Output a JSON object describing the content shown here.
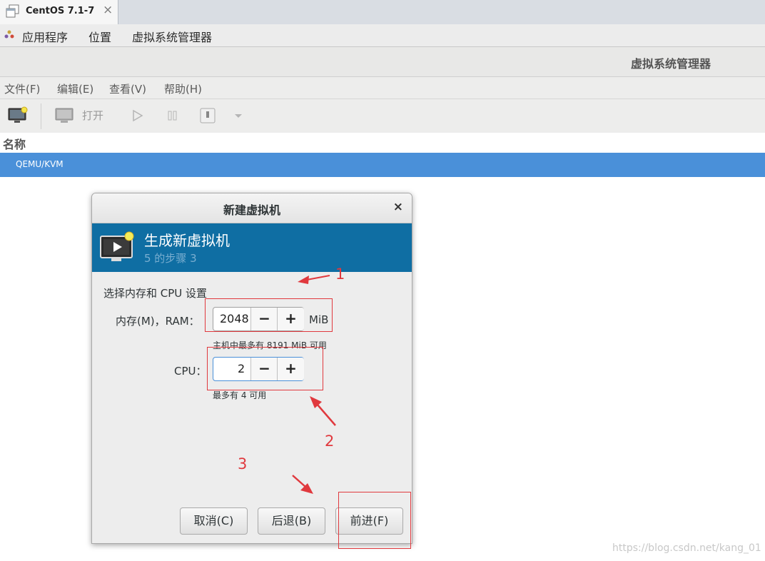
{
  "tab": {
    "title": "CentOS 7.1-7",
    "close": "×"
  },
  "top_menu": {
    "applications": "应用程序",
    "places": "位置",
    "vmm": "虚拟系统管理器"
  },
  "window_title": "虚拟系统管理器",
  "menubar": {
    "file": "文件(F)",
    "edit": "编辑(E)",
    "view": "查看(V)",
    "help": "帮助(H)"
  },
  "toolbar": {
    "open_label": "打开"
  },
  "list": {
    "header": "名称",
    "rows": [
      "QEMU/KVM"
    ]
  },
  "dialog": {
    "title": "新建虚拟机",
    "close": "×",
    "banner_title": "生成新虚拟机",
    "banner_subtitle": "5 的步骤 3",
    "section_label": "选择内存和 CPU 设置",
    "memory": {
      "label": "内存(M)，RAM：",
      "value": "2048",
      "unit": "MiB",
      "hint": "主机中最多有 8191 MiB 可用",
      "minus": "−",
      "plus": "+"
    },
    "cpu": {
      "label": "CPU：",
      "value": "2",
      "hint": "最多有 4 可用",
      "minus": "−",
      "plus": "+"
    },
    "buttons": {
      "cancel": "取消(C)",
      "back": "后退(B)",
      "forward": "前进(F)"
    }
  },
  "annotations": {
    "n1": "1",
    "n2": "2",
    "n3": "3"
  },
  "watermark": "https://blog.csdn.net/kang_01",
  "colors": {
    "selection": "#4a90d9",
    "banner": "#0f6ea3",
    "annotation": "#e0393e"
  }
}
